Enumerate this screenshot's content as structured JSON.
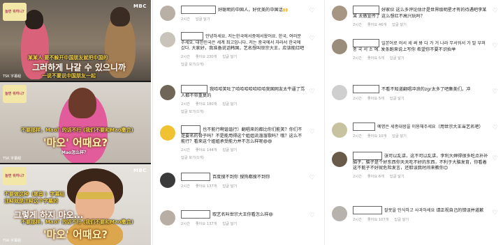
{
  "video": {
    "frames": [
      {
        "logo": "놀면 뭐하니?",
        "broadcaster": "MBC",
        "channel": "TSK 字幕組",
        "subtitle_cn": "某某人 要不躲开中国朋友就把中国的",
        "subtitle_ko": "그러하게 나갈 수 있으니까",
        "subtitle_cn_2": "一说不要说中国朋友一起"
      },
      {
        "logo": "놀면 뭐하니?",
        "channel": "TSK 字幕組",
        "subtitle_cn": "不要那样，Mao？的话不行 (我们不要和Mao撒合)",
        "subtitle_ko": "'마오' 어때요?",
        "subtitle_small": "Mao怎么样？"
      },
      {
        "logo": "놀면 뭐하니?",
        "broadcaster": "MBC",
        "channel": "TSK 字幕組",
        "subtitle_cn": "不要做这种（尾音 ）字幕组注释就是注释这个字幕的",
        "subtitle_ko": "그렇게 하지 마오...",
        "subtitle_cn_2": "不要那样，Mao？的话不行 (我们不要和Mao撒合)",
        "subtitle_ko_2": "'마오' 어때요?"
      }
    ]
  },
  "comments_middle": [
    {
      "text": "好聪明的中国人，好优美的中国话🙌",
      "time": "2시간",
      "likes": "",
      "reply": "답글 달기",
      "replies": "",
      "avatar_color": "#b8b0a4"
    },
    {
      "text": "안녕하세요. 저는한국에서중에서왔어요. 한국, 여러분 주세요. 대한민국은 세계 최고입니다. 저는 중국에서 자라서 한국에 갔다. 大家好，我准备说话韩国，艺名想叫世宗大王，应该能红吧",
      "time": "2시간",
      "likes": "좋아요 230개",
      "reply": "답글 달기",
      "replies": "답글 보기(1개)",
      "avatar_color": "#c9c3ba"
    },
    {
      "text": "我哈哈笑吐了哈哈哈哈哈哈哈我国网友太牛逼了骂人都不带重复的",
      "time": "2시간",
      "likes": "좋아요 180개",
      "reply": "답글 달기",
      "replies": "답글 보기(1개)",
      "avatar_color": "#6f6658"
    },
    {
      "text": "也不能行啊谐谐行）翻唱来的都比你们能笑？你们不是要名的骨子吗？不是能用得这个姐姐流溜溜歌吗？哦？这么不能行？看来这个姐姐承受能力并不怎么样呢😄😄",
      "time": "2시간",
      "likes": "좋아요 144개",
      "reply": "답글 달기",
      "replies": "답글 보기(1개)",
      "avatar_color": "#f0c232"
    },
    {
      "text": "百度搜不到你 搜狗都搜不到你",
      "time": "2시간",
      "likes": "좋아요 137개",
      "reply": "답글 달기",
      "replies": "",
      "avatar_color": "#3a3a3a"
    },
    {
      "text": "取艺名叫世宗大王你看怎么样😆",
      "time": "2시간",
      "likes": "좋아요 137개",
      "reply": "답글 달기",
      "replies": "",
      "avatar_color": "#b9aea3"
    }
  ],
  "comments_right": [
    {
      "text": "好家伙 这么多评论估计是世界级明星才有的待遇吧李某某 太傲宣传了 这么想红不高兴玩吗？",
      "time": "2시간",
      "likes": "좋아요 46개",
      "reply": "답글 달기",
      "replies": "",
      "avatar_color": "#a79683"
    },
    {
      "text": "일본어로 어서 세 써 봐 다 가 거 나라 무서워서 가 말 부쳐 중 국 서 소 예. 发条跑来说上写你 希望你不要不识抬举",
      "time": "2시간",
      "likes": "좋아요 5개",
      "reply": "답글 달기",
      "replies": "",
      "avatar_color": "#9b8d7b"
    },
    {
      "text": "不看不知道翻唱冲浪的zgr太多了吧集美们，冲",
      "time": "2시간",
      "likes": "좋아요 5개",
      "reply": "답글 달기",
      "replies": "",
      "avatar_color": "#cfcfcf"
    },
    {
      "text": "예명은 세종대왕을 이용해주세요（用世宗大王当艺名吧）",
      "time": "2시간",
      "likes": "좋아요 10개",
      "reply": "답글 달기",
      "replies": "",
      "avatar_color": "#c7c2a0"
    },
    {
      "text": "张可以乱讲，这不可以乱讲，李利大婶得很多吃点补补脑子，脑子是个好东西你天天吃不好的东西，不利于大脑发育，你看着这不能子不好就危险发言，还取误我时间来教你😊",
      "time": "2시간",
      "likes": "좋아요 6개",
      "reply": "답글 달기",
      "replies": "",
      "avatar_color": "#6a5a4a"
    },
    {
      "text": "잘못을 인식하고 사과하세요 请正视自己的错误并道歉",
      "time": "2시간",
      "likes": "좋아요 107개",
      "reply": "답글 달기",
      "replies": "",
      "avatar_color": "#b8b2ac"
    }
  ]
}
